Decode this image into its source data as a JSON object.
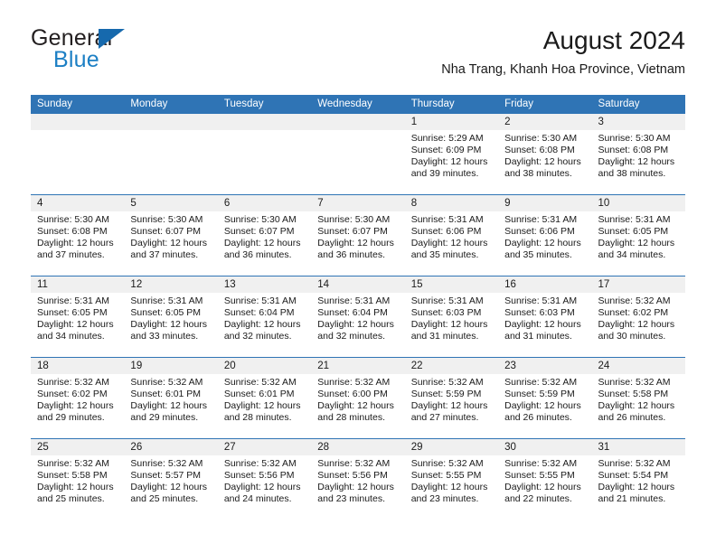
{
  "brand": {
    "name_top": "General",
    "name_bottom": "Blue",
    "triangle_icon": "triangle-logo-icon",
    "accent_color": "#1c7fc4",
    "header_blue": "#2f74b5"
  },
  "header": {
    "month_title": "August 2024",
    "location": "Nha Trang, Khanh Hoa Province, Vietnam"
  },
  "calendar": {
    "weekday_headers": [
      "Sunday",
      "Monday",
      "Tuesday",
      "Wednesday",
      "Thursday",
      "Friday",
      "Saturday"
    ],
    "weeks": [
      {
        "days": [
          {
            "date": "",
            "lines": []
          },
          {
            "date": "",
            "lines": []
          },
          {
            "date": "",
            "lines": []
          },
          {
            "date": "",
            "lines": []
          },
          {
            "date": "1",
            "lines": [
              "Sunrise: 5:29 AM",
              "Sunset: 6:09 PM",
              "Daylight: 12 hours",
              "and 39 minutes."
            ]
          },
          {
            "date": "2",
            "lines": [
              "Sunrise: 5:30 AM",
              "Sunset: 6:08 PM",
              "Daylight: 12 hours",
              "and 38 minutes."
            ]
          },
          {
            "date": "3",
            "lines": [
              "Sunrise: 5:30 AM",
              "Sunset: 6:08 PM",
              "Daylight: 12 hours",
              "and 38 minutes."
            ]
          }
        ]
      },
      {
        "days": [
          {
            "date": "4",
            "lines": [
              "Sunrise: 5:30 AM",
              "Sunset: 6:08 PM",
              "Daylight: 12 hours",
              "and 37 minutes."
            ]
          },
          {
            "date": "5",
            "lines": [
              "Sunrise: 5:30 AM",
              "Sunset: 6:07 PM",
              "Daylight: 12 hours",
              "and 37 minutes."
            ]
          },
          {
            "date": "6",
            "lines": [
              "Sunrise: 5:30 AM",
              "Sunset: 6:07 PM",
              "Daylight: 12 hours",
              "and 36 minutes."
            ]
          },
          {
            "date": "7",
            "lines": [
              "Sunrise: 5:30 AM",
              "Sunset: 6:07 PM",
              "Daylight: 12 hours",
              "and 36 minutes."
            ]
          },
          {
            "date": "8",
            "lines": [
              "Sunrise: 5:31 AM",
              "Sunset: 6:06 PM",
              "Daylight: 12 hours",
              "and 35 minutes."
            ]
          },
          {
            "date": "9",
            "lines": [
              "Sunrise: 5:31 AM",
              "Sunset: 6:06 PM",
              "Daylight: 12 hours",
              "and 35 minutes."
            ]
          },
          {
            "date": "10",
            "lines": [
              "Sunrise: 5:31 AM",
              "Sunset: 6:05 PM",
              "Daylight: 12 hours",
              "and 34 minutes."
            ]
          }
        ]
      },
      {
        "days": [
          {
            "date": "11",
            "lines": [
              "Sunrise: 5:31 AM",
              "Sunset: 6:05 PM",
              "Daylight: 12 hours",
              "and 34 minutes."
            ]
          },
          {
            "date": "12",
            "lines": [
              "Sunrise: 5:31 AM",
              "Sunset: 6:05 PM",
              "Daylight: 12 hours",
              "and 33 minutes."
            ]
          },
          {
            "date": "13",
            "lines": [
              "Sunrise: 5:31 AM",
              "Sunset: 6:04 PM",
              "Daylight: 12 hours",
              "and 32 minutes."
            ]
          },
          {
            "date": "14",
            "lines": [
              "Sunrise: 5:31 AM",
              "Sunset: 6:04 PM",
              "Daylight: 12 hours",
              "and 32 minutes."
            ]
          },
          {
            "date": "15",
            "lines": [
              "Sunrise: 5:31 AM",
              "Sunset: 6:03 PM",
              "Daylight: 12 hours",
              "and 31 minutes."
            ]
          },
          {
            "date": "16",
            "lines": [
              "Sunrise: 5:31 AM",
              "Sunset: 6:03 PM",
              "Daylight: 12 hours",
              "and 31 minutes."
            ]
          },
          {
            "date": "17",
            "lines": [
              "Sunrise: 5:32 AM",
              "Sunset: 6:02 PM",
              "Daylight: 12 hours",
              "and 30 minutes."
            ]
          }
        ]
      },
      {
        "days": [
          {
            "date": "18",
            "lines": [
              "Sunrise: 5:32 AM",
              "Sunset: 6:02 PM",
              "Daylight: 12 hours",
              "and 29 minutes."
            ]
          },
          {
            "date": "19",
            "lines": [
              "Sunrise: 5:32 AM",
              "Sunset: 6:01 PM",
              "Daylight: 12 hours",
              "and 29 minutes."
            ]
          },
          {
            "date": "20",
            "lines": [
              "Sunrise: 5:32 AM",
              "Sunset: 6:01 PM",
              "Daylight: 12 hours",
              "and 28 minutes."
            ]
          },
          {
            "date": "21",
            "lines": [
              "Sunrise: 5:32 AM",
              "Sunset: 6:00 PM",
              "Daylight: 12 hours",
              "and 28 minutes."
            ]
          },
          {
            "date": "22",
            "lines": [
              "Sunrise: 5:32 AM",
              "Sunset: 5:59 PM",
              "Daylight: 12 hours",
              "and 27 minutes."
            ]
          },
          {
            "date": "23",
            "lines": [
              "Sunrise: 5:32 AM",
              "Sunset: 5:59 PM",
              "Daylight: 12 hours",
              "and 26 minutes."
            ]
          },
          {
            "date": "24",
            "lines": [
              "Sunrise: 5:32 AM",
              "Sunset: 5:58 PM",
              "Daylight: 12 hours",
              "and 26 minutes."
            ]
          }
        ]
      },
      {
        "days": [
          {
            "date": "25",
            "lines": [
              "Sunrise: 5:32 AM",
              "Sunset: 5:58 PM",
              "Daylight: 12 hours",
              "and 25 minutes."
            ]
          },
          {
            "date": "26",
            "lines": [
              "Sunrise: 5:32 AM",
              "Sunset: 5:57 PM",
              "Daylight: 12 hours",
              "and 25 minutes."
            ]
          },
          {
            "date": "27",
            "lines": [
              "Sunrise: 5:32 AM",
              "Sunset: 5:56 PM",
              "Daylight: 12 hours",
              "and 24 minutes."
            ]
          },
          {
            "date": "28",
            "lines": [
              "Sunrise: 5:32 AM",
              "Sunset: 5:56 PM",
              "Daylight: 12 hours",
              "and 23 minutes."
            ]
          },
          {
            "date": "29",
            "lines": [
              "Sunrise: 5:32 AM",
              "Sunset: 5:55 PM",
              "Daylight: 12 hours",
              "and 23 minutes."
            ]
          },
          {
            "date": "30",
            "lines": [
              "Sunrise: 5:32 AM",
              "Sunset: 5:55 PM",
              "Daylight: 12 hours",
              "and 22 minutes."
            ]
          },
          {
            "date": "31",
            "lines": [
              "Sunrise: 5:32 AM",
              "Sunset: 5:54 PM",
              "Daylight: 12 hours",
              "and 21 minutes."
            ]
          }
        ]
      }
    ]
  }
}
